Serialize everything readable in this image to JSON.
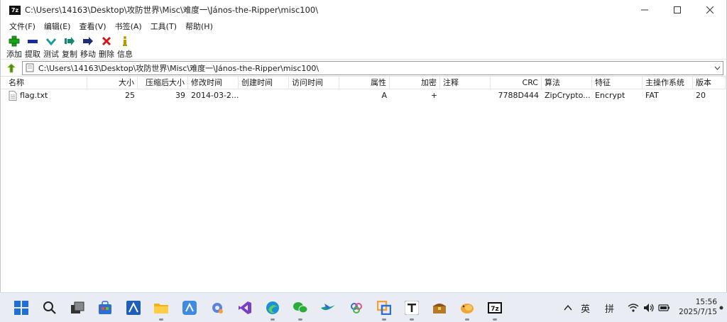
{
  "window": {
    "title": "C:\\Users\\14163\\Desktop\\攻防世界\\Misc\\难度一\\János-the-Ripper\\misc100\\",
    "app_icon_text": "7z"
  },
  "menu": [
    "文件(F)",
    "编辑(E)",
    "查看(V)",
    "书签(A)",
    "工具(T)",
    "帮助(H)"
  ],
  "toolbar": {
    "add": "添加",
    "extract": "提取",
    "test": "测试",
    "copy": "复制",
    "move": "移动",
    "delete": "删除",
    "info": "信息"
  },
  "address": {
    "path": "C:\\Users\\14163\\Desktop\\攻防世界\\Misc\\难度一\\János-the-Ripper\\misc100\\"
  },
  "columns": {
    "name": "名称",
    "size": "大小",
    "packed": "压缩后大小",
    "modified": "修改时间",
    "created": "创建时间",
    "accessed": "访问时间",
    "attributes": "属性",
    "encrypted": "加密",
    "comment": "注释",
    "crc": "CRC",
    "method": "算法",
    "characteristics": "特征",
    "host_os": "主操作系统",
    "version": "版本"
  },
  "file": {
    "name": "flag.txt",
    "size": "25",
    "packed": "39",
    "modified": "2014-03-2...",
    "attributes": "A",
    "encrypted": "+",
    "crc": "7788D444",
    "method": "ZipCrypto...",
    "characteristics": "Encrypt",
    "host_os": "FAT",
    "version": "20"
  },
  "tray": {
    "ime_lang": "英",
    "ime_mode": "拼",
    "time": "15:56",
    "date": "2025/7/15"
  },
  "colors": {
    "add": "#1aa31a",
    "extract": "#1a2c9e",
    "test": "#1a9ea0",
    "copy": "#15866f",
    "move": "#1a2c7a",
    "delete": "#d11a1a",
    "info": "#b89a00"
  }
}
